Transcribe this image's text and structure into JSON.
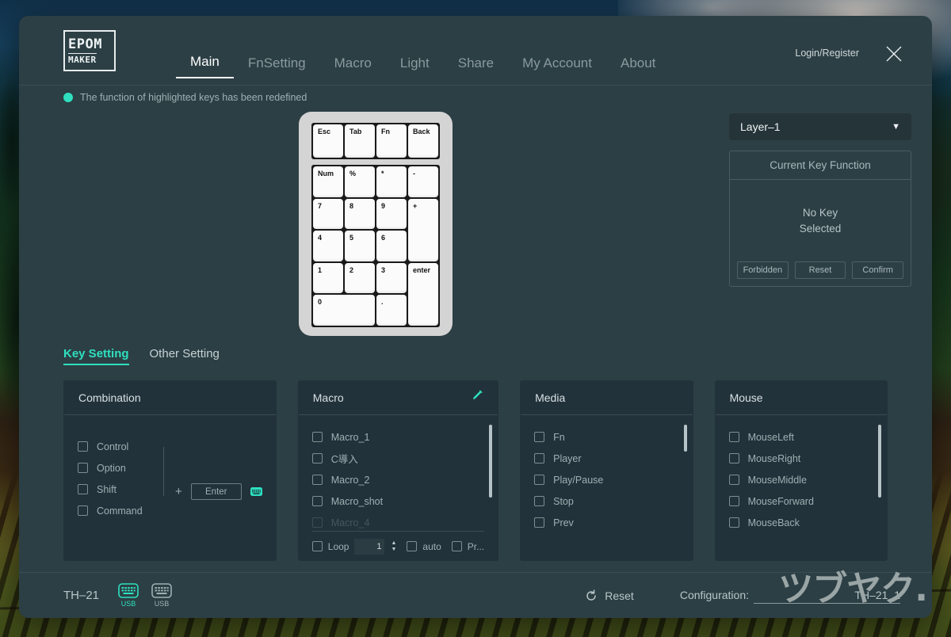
{
  "app": {
    "logo_line1": "EPOM",
    "logo_line2": "MAKER",
    "login_label": "Login/Register",
    "close_icon": "close-icon"
  },
  "nav": {
    "tabs": [
      {
        "label": "Main",
        "active": true
      },
      {
        "label": "FnSetting",
        "active": false
      },
      {
        "label": "Macro",
        "active": false
      },
      {
        "label": "Light",
        "active": false
      },
      {
        "label": "Share",
        "active": false
      },
      {
        "label": "My Account",
        "active": false
      },
      {
        "label": "About",
        "active": false
      }
    ]
  },
  "notice": {
    "text": "The function of highlighted keys has been redefined",
    "dot_color": "#2ee0c0"
  },
  "keypad": {
    "top_row": [
      "Esc",
      "Tab",
      "Fn",
      "Back"
    ],
    "main_keys": [
      {
        "label": "Num"
      },
      {
        "label": "%"
      },
      {
        "label": "*"
      },
      {
        "label": "-"
      },
      {
        "label": "7"
      },
      {
        "label": "8"
      },
      {
        "label": "9"
      },
      {
        "label": "+",
        "tall": true
      },
      {
        "label": "4"
      },
      {
        "label": "5"
      },
      {
        "label": "6"
      },
      {
        "label": "1"
      },
      {
        "label": "2"
      },
      {
        "label": "3"
      },
      {
        "label": "enter",
        "tall": true
      },
      {
        "label": "0",
        "wide": true
      },
      {
        "label": "."
      }
    ]
  },
  "right_panel": {
    "layer_value": "Layer–1",
    "layer_caret": "▼",
    "ckf_title": "Current Key Function",
    "ckf_body_line1": "No Key",
    "ckf_body_line2": "Selected",
    "buttons": [
      {
        "label": "Forbidden"
      },
      {
        "label": "Reset"
      },
      {
        "label": "Confirm"
      }
    ]
  },
  "sub_tabs": [
    {
      "label": "Key Setting",
      "active": true
    },
    {
      "label": "Other Setting",
      "active": false
    }
  ],
  "cards": {
    "combination": {
      "title": "Combination",
      "modifiers": [
        "Control",
        "Option",
        "Shift",
        "Command"
      ],
      "plus": "+",
      "key_value": "Enter",
      "keyboard_icon": "keyboard-icon"
    },
    "macro": {
      "title": "Macro",
      "edit_icon": "pencil-edit-icon",
      "items": [
        "Macro_1",
        "C導入",
        "Macro_2",
        "Macro_shot",
        "Macro_4"
      ],
      "loop_label": "Loop",
      "loop_value": "1",
      "auto_label": "auto",
      "pr_label": "Pr..."
    },
    "media": {
      "title": "Media",
      "items": [
        "Fn",
        "Player",
        "Play/Pause",
        "Stop",
        "Prev"
      ]
    },
    "mouse": {
      "title": "Mouse",
      "items": [
        "MouseLeft",
        "MouseRight",
        "MouseMiddle",
        "MouseForward",
        "MouseBack"
      ]
    }
  },
  "footer": {
    "device_name": "TH–21",
    "connections": [
      {
        "label": "USB",
        "active": true,
        "icon": "keyboard-icon"
      },
      {
        "label": "USB",
        "active": false,
        "icon": "keyboard-icon"
      }
    ],
    "reset_label": "Reset",
    "reset_icon": "refresh-icon",
    "config_label": "Configuration:",
    "config_value": "TH–21_1",
    "watermark": "ツブヤク."
  },
  "colors": {
    "accent": "#2ee0c0",
    "window_bg": "#2c3f44",
    "card_bg": "#22323a",
    "text_primary": "#d6e0e3",
    "text_muted": "#9fb0b4"
  }
}
